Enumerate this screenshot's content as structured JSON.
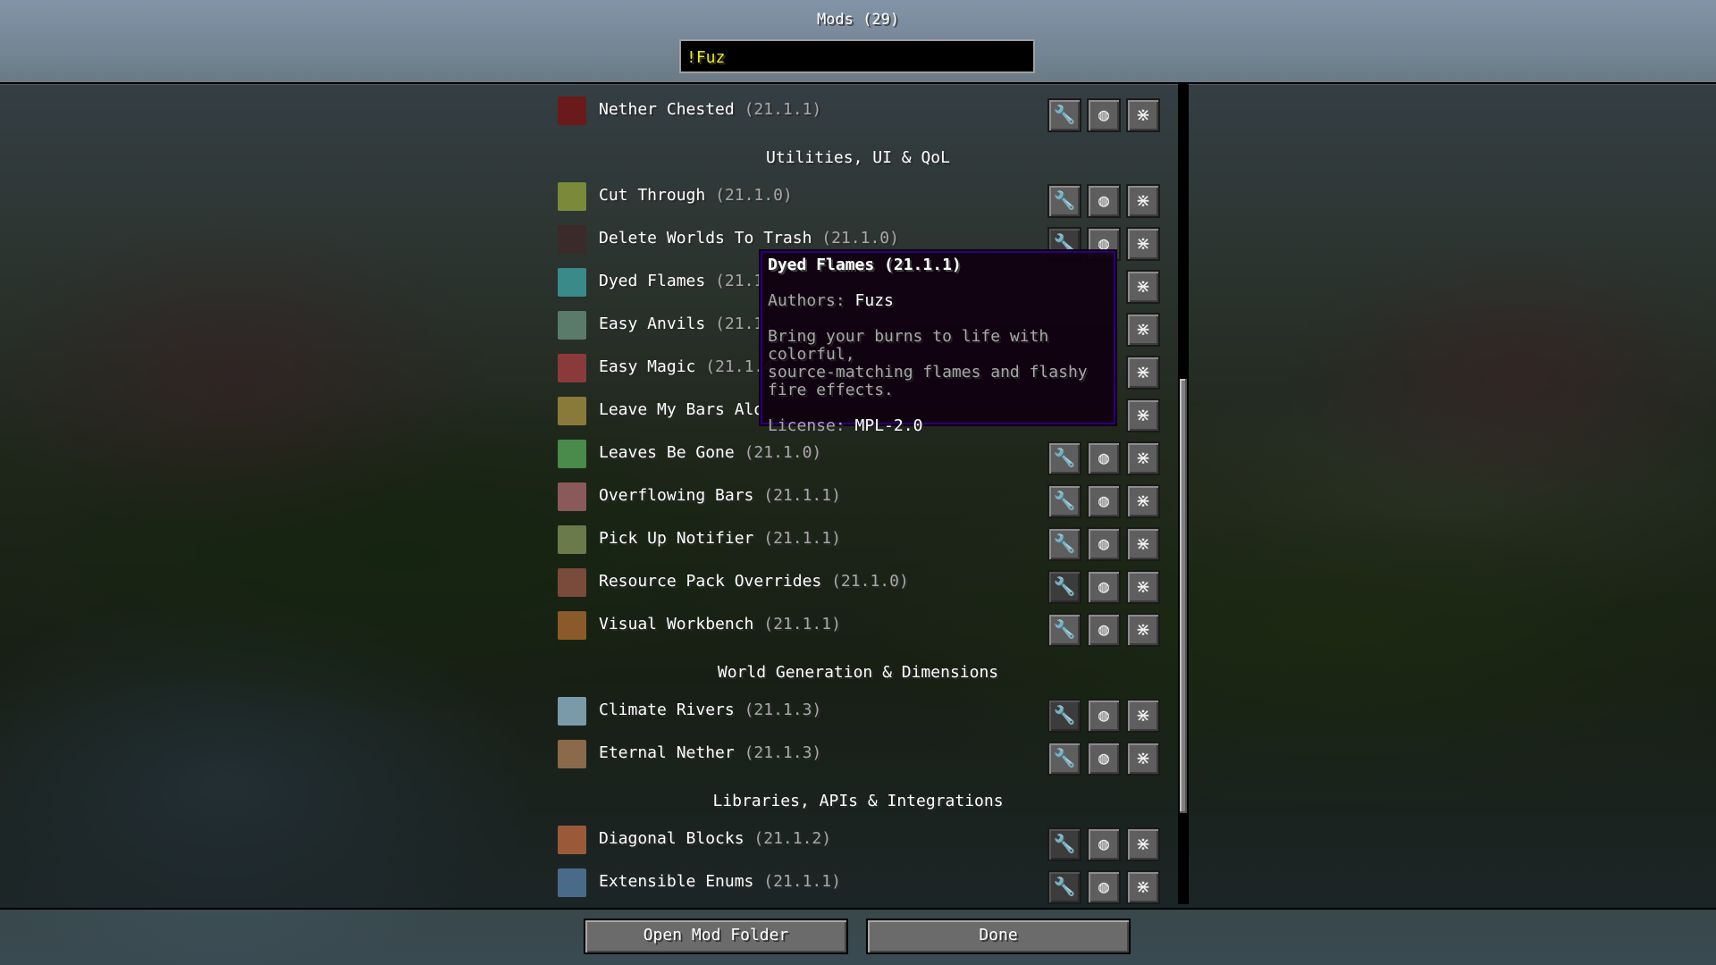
{
  "title": "Mods (29)",
  "search": {
    "value": "!Fuz"
  },
  "buttons": {
    "config_icon": "wrench-icon",
    "website_icon": "globe-icon",
    "issues_icon": "bug-icon"
  },
  "mods": [
    {
      "name": "Nether Chested",
      "version": "(21.1.1)",
      "icon_color": "#6a1a1a",
      "config": true
    },
    {
      "name": "Cut Through",
      "version": "(21.1.0)",
      "icon_color": "#7a8a3a",
      "config": true
    },
    {
      "name": "Delete Worlds To Trash",
      "version": "(21.1.0)",
      "icon_color": "#3a2a2a",
      "config": false
    },
    {
      "name": "Dyed Flames",
      "version": "(21.1",
      "icon_color": "#3a8a8a",
      "config": true
    },
    {
      "name": "Easy Anvils",
      "version": "(21.1.",
      "icon_color": "#5a7a6a",
      "config": true
    },
    {
      "name": "Easy Magic",
      "version": "(21.1.4",
      "icon_color": "#8a3a3a",
      "config": true
    },
    {
      "name": "Leave My Bars Alo",
      "version": "",
      "icon_color": "#8a7a3a",
      "config": true
    },
    {
      "name": "Leaves Be Gone",
      "version": "(21.1.0)",
      "icon_color": "#4a8a4a",
      "config": true
    },
    {
      "name": "Overflowing Bars",
      "version": "(21.1.1)",
      "icon_color": "#8a5a5a",
      "config": true
    },
    {
      "name": "Pick Up Notifier",
      "version": "(21.1.1)",
      "icon_color": "#6a7a4a",
      "config": true
    },
    {
      "name": "Resource Pack Overrides",
      "version": "(21.1.0)",
      "icon_color": "#7a4a3a",
      "config": false
    },
    {
      "name": "Visual Workbench",
      "version": "(21.1.1)",
      "icon_color": "#8a5a2a",
      "config": true
    },
    {
      "name": "Climate Rivers",
      "version": "(21.1.3)",
      "icon_color": "#7a9aaa",
      "config": false
    },
    {
      "name": "Eternal Nether",
      "version": "(21.1.3)",
      "icon_color": "#8a6a4a",
      "config": true
    },
    {
      "name": "Diagonal Blocks",
      "version": "(21.1.2)",
      "icon_color": "#9a5a3a",
      "config": false
    },
    {
      "name": "Extensible Enums",
      "version": "(21.1.1)",
      "icon_color": "#4a6a8a",
      "config": false
    }
  ],
  "categories": [
    "Utilities, UI & QoL",
    "World Generation & Dimensions",
    "Libraries, APIs & Integrations"
  ],
  "tooltip": {
    "title": "Dyed Flames (21.1.1)",
    "authors_label": "Authors: ",
    "authors": "Fuzs",
    "description_1": "Bring your burns to life with colorful,",
    "description_2": "source-matching flames and flashy",
    "description_3": "fire effects.",
    "license_label": "License: ",
    "license": "MPL-2.0"
  },
  "footer": {
    "open_folder": "Open Mod Folder",
    "done": "Done"
  }
}
